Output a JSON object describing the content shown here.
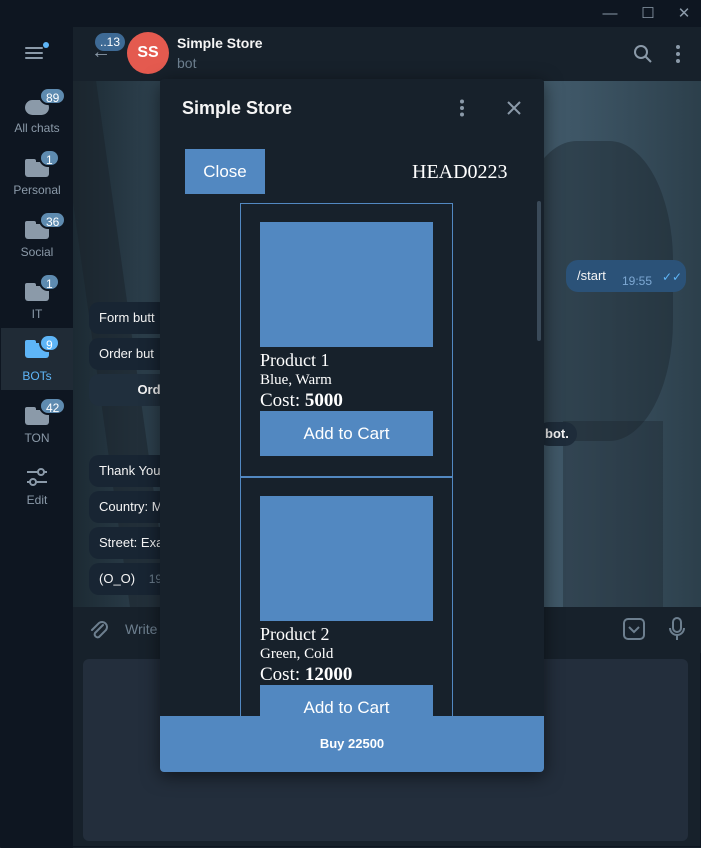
{
  "window": {
    "minimize_glyph": "—",
    "maximize_glyph": "☐",
    "close_glyph": "✕"
  },
  "sidebar": {
    "folders": [
      {
        "label": "All chats",
        "badge": "89"
      },
      {
        "label": "Personal",
        "badge": "1"
      },
      {
        "label": "Social",
        "badge": "36"
      },
      {
        "label": "IT",
        "badge": "1"
      },
      {
        "label": "BOTs",
        "badge": "9"
      },
      {
        "label": "TON",
        "badge": "42"
      }
    ],
    "edit_label": "Edit"
  },
  "header": {
    "back_badge": "..13",
    "avatar_initials": "SS",
    "title": "Simple Store",
    "subtitle": "bot"
  },
  "chat": {
    "messages_left": [
      "Form butt",
      "Order but",
      "Ord",
      "Thank You",
      "Country: M",
      "Street: Exa",
      "(O_O)"
    ],
    "left_time": "19",
    "outgoing": {
      "text": "/start",
      "time": "19:55"
    },
    "service_text": "bot."
  },
  "composer": {
    "placeholder": "Write"
  },
  "webapp": {
    "title": "Simple Store",
    "close_button": "Close",
    "order_id": "HEAD0223",
    "products": [
      {
        "name": "Product 1",
        "desc": "Blue, Warm",
        "cost_label": "Cost:",
        "cost": "5000",
        "button": "Add to Cart"
      },
      {
        "name": "Product 2",
        "desc": "Green, Cold",
        "cost_label": "Cost:",
        "cost": "12000",
        "button": "Add to Cart"
      }
    ],
    "buy_button": "Buy 22500"
  },
  "colors": {
    "accent": "#5288c1",
    "badge": "#5eb5f7",
    "background": "#17212b",
    "avatar": "#e45a4f"
  }
}
